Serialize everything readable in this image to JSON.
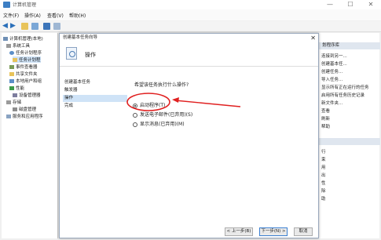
{
  "window": {
    "title": "计算机管理",
    "minimize": "—",
    "maximize": "☐",
    "close": "✕"
  },
  "menu": [
    "文件(F)",
    "操作(A)",
    "查看(V)",
    "帮助(H)"
  ],
  "tree": {
    "items": [
      {
        "label": "计算机管理(本地)",
        "indent": 0
      },
      {
        "label": "系统工具",
        "indent": 1
      },
      {
        "label": "任务计划程序",
        "indent": 2
      },
      {
        "label": "任务计划程",
        "indent": 3
      },
      {
        "label": "事件查看器",
        "indent": 2
      },
      {
        "label": "共享文件夹",
        "indent": 2
      },
      {
        "label": "本地用户和组",
        "indent": 2
      },
      {
        "label": "性能",
        "indent": 2
      },
      {
        "label": "设备管理器",
        "indent": 2
      },
      {
        "label": "存储",
        "indent": 1
      },
      {
        "label": "磁盘管理",
        "indent": 2
      },
      {
        "label": "服务和应用程序",
        "indent": 1
      }
    ]
  },
  "dialog": {
    "title": "创建基本任务向导",
    "close": "✕",
    "heading": "操作",
    "steps": [
      "创建基本任务",
      "触发器",
      "操作",
      "完成"
    ],
    "selected_step": 2,
    "prompt": "希望该任务执行什么操作?",
    "options": [
      "启动程序(T)",
      "发送电子邮件(已弃用)(S)",
      "显示消息(已弃用)(M)"
    ],
    "selected_option": 0,
    "buttons": {
      "back": "< 上一步(B)",
      "next": "下一步(N) >",
      "cancel": "取消"
    }
  },
  "actions": {
    "header": "划程序库",
    "items": [
      "连接到另一...",
      "创建基本任...",
      "创建任务...",
      "导入任务...",
      "显示所有正在运行的任务",
      "启用所有任务历史记录",
      "新文件夹...",
      "查看",
      "刷新",
      "帮助"
    ],
    "header2": "",
    "items2": [
      "行",
      "束",
      "用",
      "出",
      "性",
      "除",
      "助"
    ]
  },
  "annotation": {
    "color": "#e02020"
  }
}
